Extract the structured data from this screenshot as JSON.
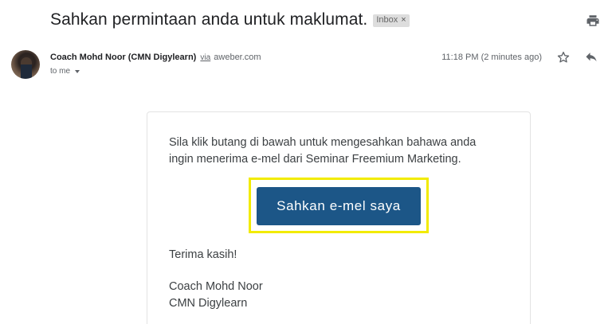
{
  "email": {
    "subject": "Sahkan permintaan anda untuk maklumat.",
    "label_chip": "Inbox",
    "label_chip_remove": "×",
    "sender_name": "Coach Mohd Noor (CMN Digylearn)",
    "via_text": "via",
    "via_domain": "aweber.com",
    "recipient": "to me",
    "timestamp": "11:18 PM (2 minutes ago)"
  },
  "icons": {
    "print": "print-icon",
    "star": "star-icon",
    "reply": "reply-icon",
    "caret": "chevron-down-icon",
    "avatar": "avatar"
  },
  "message": {
    "intro": "Sila klik butang di bawah untuk mengesahkan bahawa anda\ningin menerima e-mel dari Seminar Freemium Marketing.",
    "button_label": "Sahkan e-mel saya",
    "thanks": "Terima kasih!",
    "signature_name": "Coach Mohd Noor",
    "signature_company": "CMN Digylearn"
  },
  "colors": {
    "button_bg": "#1c5687",
    "highlight": "#f2eb00",
    "chip_bg": "#dddddd"
  }
}
